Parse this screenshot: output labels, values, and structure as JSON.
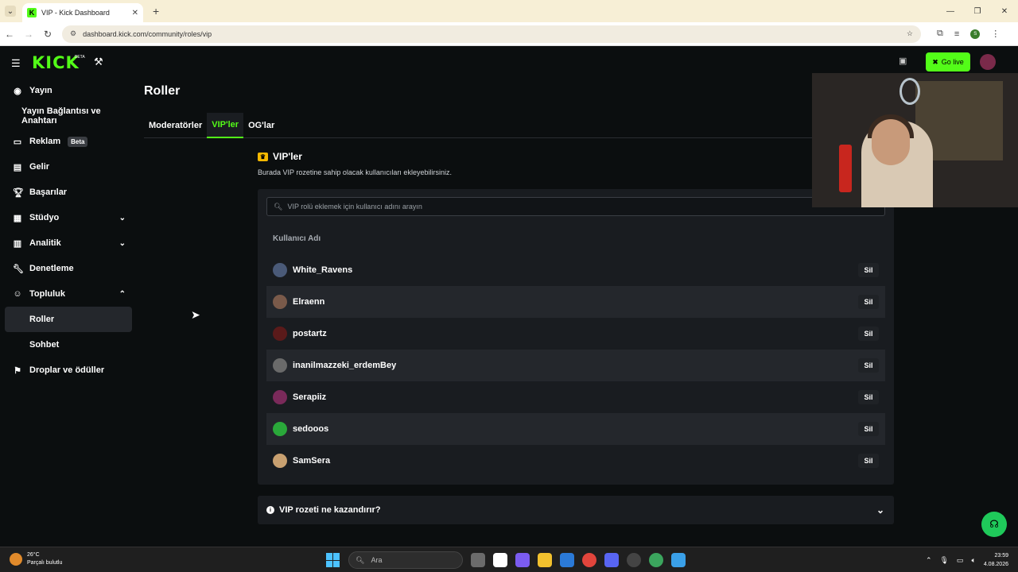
{
  "browser": {
    "tab_title": "VIP - Kick Dashboard",
    "url": "dashboard.kick.com/community/roles/vip",
    "profile_initial": "S"
  },
  "header": {
    "logo": "KICK",
    "logo_badge": "BETA",
    "go_live": "Go live"
  },
  "sidebar": {
    "items": [
      {
        "label": "Yayın",
        "icon": "broadcast-icon"
      },
      {
        "label": "Yayın Bağlantısı ve Anahtarı",
        "icon": ""
      },
      {
        "label": "Reklam",
        "icon": "ad-icon",
        "badge": "Beta"
      },
      {
        "label": "Gelir",
        "icon": "revenue-icon"
      },
      {
        "label": "Başarılar",
        "icon": "trophy-icon"
      },
      {
        "label": "Stüdyo",
        "icon": "studio-icon"
      },
      {
        "label": "Analitik",
        "icon": "analytics-icon"
      },
      {
        "label": "Denetleme",
        "icon": "wrench-icon"
      },
      {
        "label": "Topluluk",
        "icon": "community-icon"
      },
      {
        "label": "Roller",
        "icon": ""
      },
      {
        "label": "Sohbet",
        "icon": ""
      },
      {
        "label": "Droplar ve ödüller",
        "icon": "drops-icon"
      }
    ]
  },
  "main": {
    "title": "Roller",
    "tabs": [
      "Moderatörler",
      "VIP'ler",
      "OG'lar"
    ],
    "section_title": "VIP'ler",
    "section_desc": "Burada VIP rozetine sahip olacak kullanıcıları ekleyebilirsiniz.",
    "search_placeholder": "VIP rolü eklemek için kullanıcı adını arayın",
    "column_header": "Kullanıcı Adı",
    "remove_label": "Sil",
    "users": [
      {
        "name": "White_Ravens",
        "color": "#4a5a78"
      },
      {
        "name": "Elraenn",
        "color": "#7a5a4a"
      },
      {
        "name": "postartz",
        "color": "#5a1a1a"
      },
      {
        "name": "inanilmazzeki_erdemBey",
        "color": "#6a6a6a"
      },
      {
        "name": "Serapiiz",
        "color": "#7a2a5a"
      },
      {
        "name": "sedooos",
        "color": "#2aa83a"
      },
      {
        "name": "SamSera",
        "color": "#c8a070"
      }
    ],
    "faq": "VIP rozeti ne kazandırır?"
  },
  "taskbar": {
    "temp": "26°C",
    "weather": "Parçalı bulutlu",
    "search": "Ara",
    "time": "23:59",
    "date": "4.08.2026"
  },
  "colors": {
    "accent": "#53fc18",
    "background": "#0b0e0f",
    "card": "#191c20"
  }
}
